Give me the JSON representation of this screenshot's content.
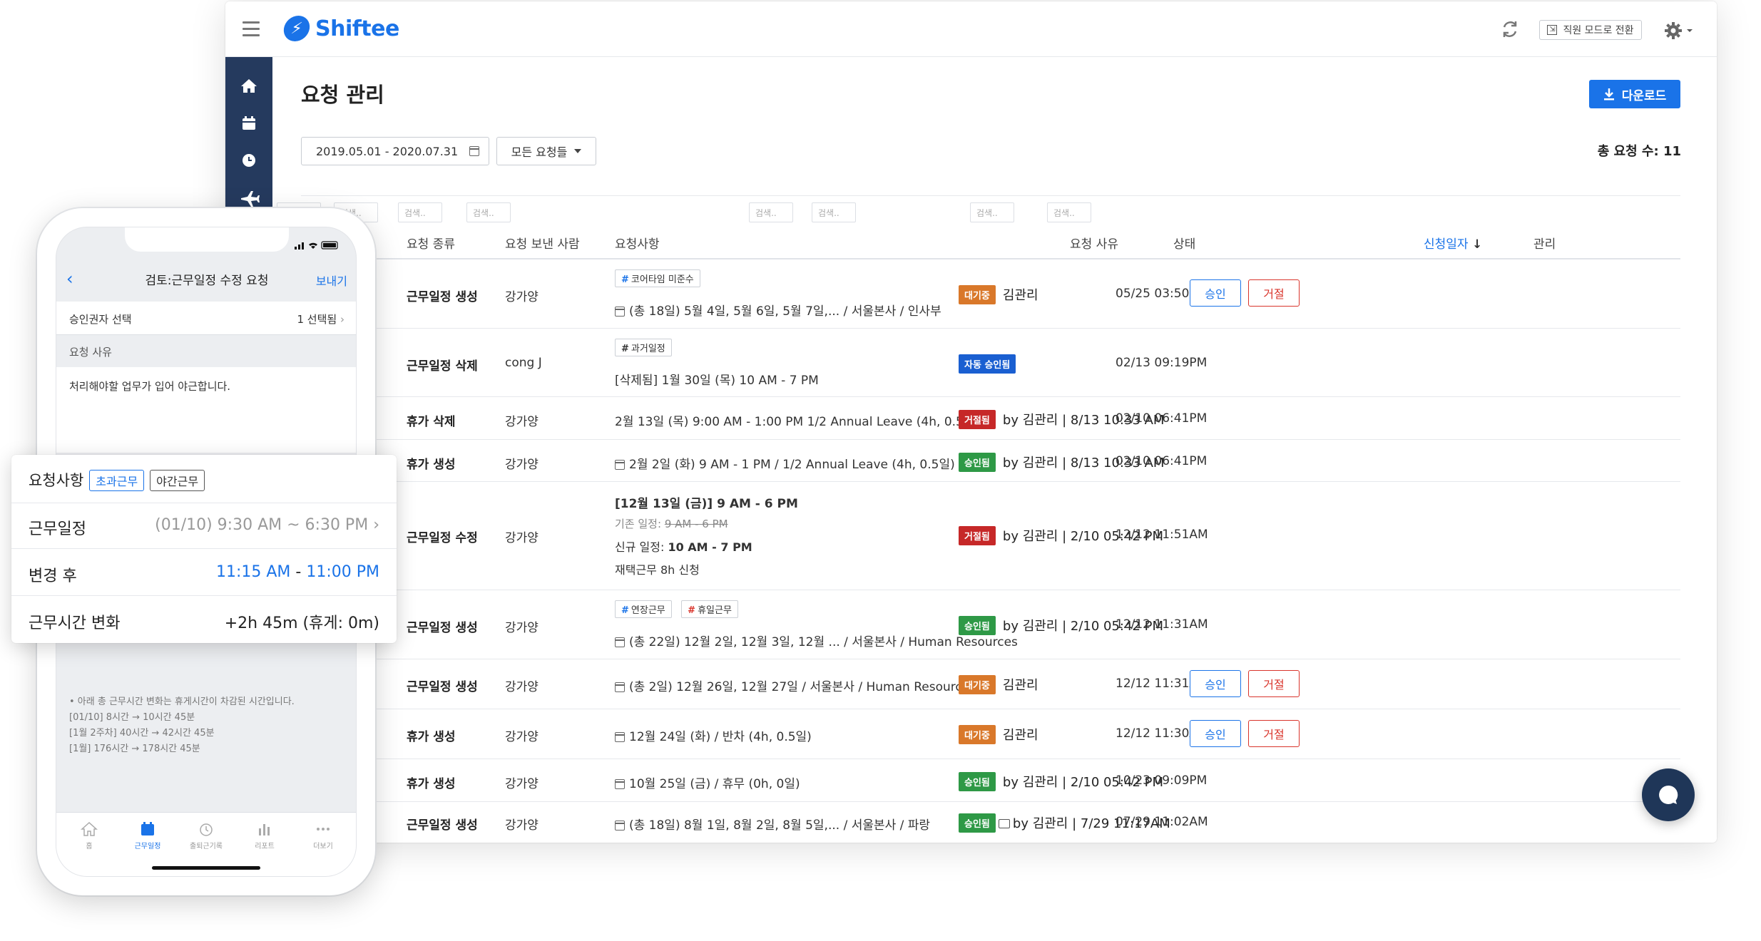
{
  "app": {
    "brand": "Shiftee",
    "switch_mode_label": "직원 모드로 전환"
  },
  "page": {
    "title": "요청 관리",
    "download_label": "다운로드",
    "date_range": "2019.05.01 - 2020.07.31",
    "request_filter": "모든 요청들",
    "total_label": "총 요청 수: 11"
  },
  "table": {
    "search_placeholder": "검색..",
    "columns": [
      "요청 종류",
      "요청 보낸 사람",
      "요청사항",
      "요청 사유",
      "상태",
      "신청일자",
      "관리"
    ],
    "sorted_column": "신청일자",
    "approve_label": "승인",
    "reject_label": "거절",
    "rows": [
      {
        "type": "근무일정 생성",
        "sender": "강가양",
        "tags": [
          "코어타임 미준수"
        ],
        "detail": "(총 18일) 5월 4일, 5월 6일, 5월 7일,... / 서울본사 / 인사부",
        "status_badge": "대기중",
        "status_text": "김관리",
        "date": "05/25 03:50PM",
        "actions": true
      },
      {
        "type": "근무일정 삭제",
        "sender": "cong J",
        "tags": [
          "과거일정"
        ],
        "detail": "[삭제됨]  1월 30일 (목) 10 AM - 7 PM",
        "status_badge": "자동 승인됨",
        "status_text": "",
        "date": "02/13 09:19PM",
        "actions": false
      },
      {
        "type": "휴가 삭제",
        "sender": "강가양",
        "detail": "2월 13일 (목) 9:00 AM - 1:00 PM 1/2 Annual Leave (4h, 0.5일)",
        "status_badge": "거절됨",
        "status_text": "by 김관리 | 8/13 10:33 AM",
        "date": "02/10 06:41PM",
        "actions": false
      },
      {
        "type": "휴가 생성",
        "sender": "강가양",
        "detail": "2월 2일 (화) 9 AM - 1 PM / 1/2 Annual Leave (4h, 0.5일)",
        "status_badge": "승인됨",
        "status_text": "by 김관리 | 8/13 10:33 AM",
        "date": "02/10 06:41PM",
        "actions": false
      },
      {
        "type": "근무일정 수정",
        "sender": "강가양",
        "detail_title": "[12월 13일 (금)] 9 AM - 6 PM",
        "old_label": "기존 일정:",
        "old_value": "9 AM - 6 PM",
        "new_label": "신규 일정:",
        "new_value": "10 AM - 7 PM",
        "detail_extra": "재택근무 8h 신청",
        "status_badge": "거절됨",
        "status_text": "by 김관리 | 2/10 05:42 PM",
        "date": "12/12 11:51AM",
        "actions": false
      },
      {
        "type": "근무일정 생성",
        "sender": "강가양",
        "tags": [
          "연장근무",
          "휴일근무"
        ],
        "detail": "(총 22일) 12월 2일, 12월 3일, 12월 ... / 서울본사 / Human Resources",
        "status_badge": "승인됨",
        "status_text": "by 김관리 | 2/10 05:42 PM",
        "date": "12/12 11:31AM",
        "actions": false
      },
      {
        "type": "근무일정 생성",
        "sender": "강가양",
        "detail": "(총 2일) 12월 26일, 12월 27일 / 서울본사 / Human Resources",
        "status_badge": "대기중",
        "status_text": "김관리",
        "date": "12/12 11:31AM",
        "actions": true
      },
      {
        "type": "휴가 생성",
        "sender": "강가양",
        "detail": "12월 24일 (화) / 반차 (4h, 0.5일)",
        "status_badge": "대기중",
        "status_text": "김관리",
        "date": "12/12 11:30AM",
        "actions": true
      },
      {
        "type": "휴가 생성",
        "sender": "강가양",
        "detail": "10월 25일 (금) / 휴무 (0h, 0일)",
        "status_badge": "승인됨",
        "status_text": "by 김관리 | 2/10 05:42 PM",
        "date": "10/23 09:09PM",
        "actions": false
      },
      {
        "type": "근무일정 생성",
        "sender": "강가양",
        "detail": "(총 18일) 8월 1일, 8월 2일, 8월 5일,... / 서울본사 / 파랑",
        "status_badge": "승인됨",
        "status_text": "by 김관리 | 7/29 11:17AM",
        "date": "07/29 11:02AM",
        "actions": false
      }
    ]
  },
  "colors": {
    "pending": "#d9782a",
    "auto_approved": "#1a5fd1",
    "rejected": "#c62828",
    "approved": "#2e9946",
    "primary": "#1a73e8",
    "sidebar": "#253a5e"
  },
  "mobile": {
    "nav_title": "검토:근무일정 수정 요청",
    "send_label": "보내기",
    "approver_label": "승인권자 선택",
    "approver_value": "1 선택됨",
    "reason_label": "요청 사유",
    "reason_text": "처리해야할 업무가 입어 야근합니다.",
    "notes": [
      "• 아래 총 근무시간 변화는 휴게시간이 차감된 시간입니다.",
      "[01/10] 8시간 → 10시간 45분",
      "[1월 2주차] 40시간 → 42시간 45분",
      "[1월] 176시간 → 178시간 45분"
    ],
    "tabs": [
      "홈",
      "근무일정",
      "출퇴근기록",
      "리포트",
      "더보기"
    ],
    "active_tab": "근무일정"
  },
  "card": {
    "items_label": "요청사항",
    "tags": [
      "초과근무",
      "야간근무"
    ],
    "schedule_label": "근무일정",
    "schedule_value": "(01/10) 9:30 AM ~ 6:30 PM",
    "after_label": "변경 후",
    "after_start": "11:15 AM",
    "after_sep": "-",
    "after_end": "11:00 PM",
    "change_label": "근무시간 변화",
    "change_value": "+2h 45m (휴게: 0m)"
  }
}
